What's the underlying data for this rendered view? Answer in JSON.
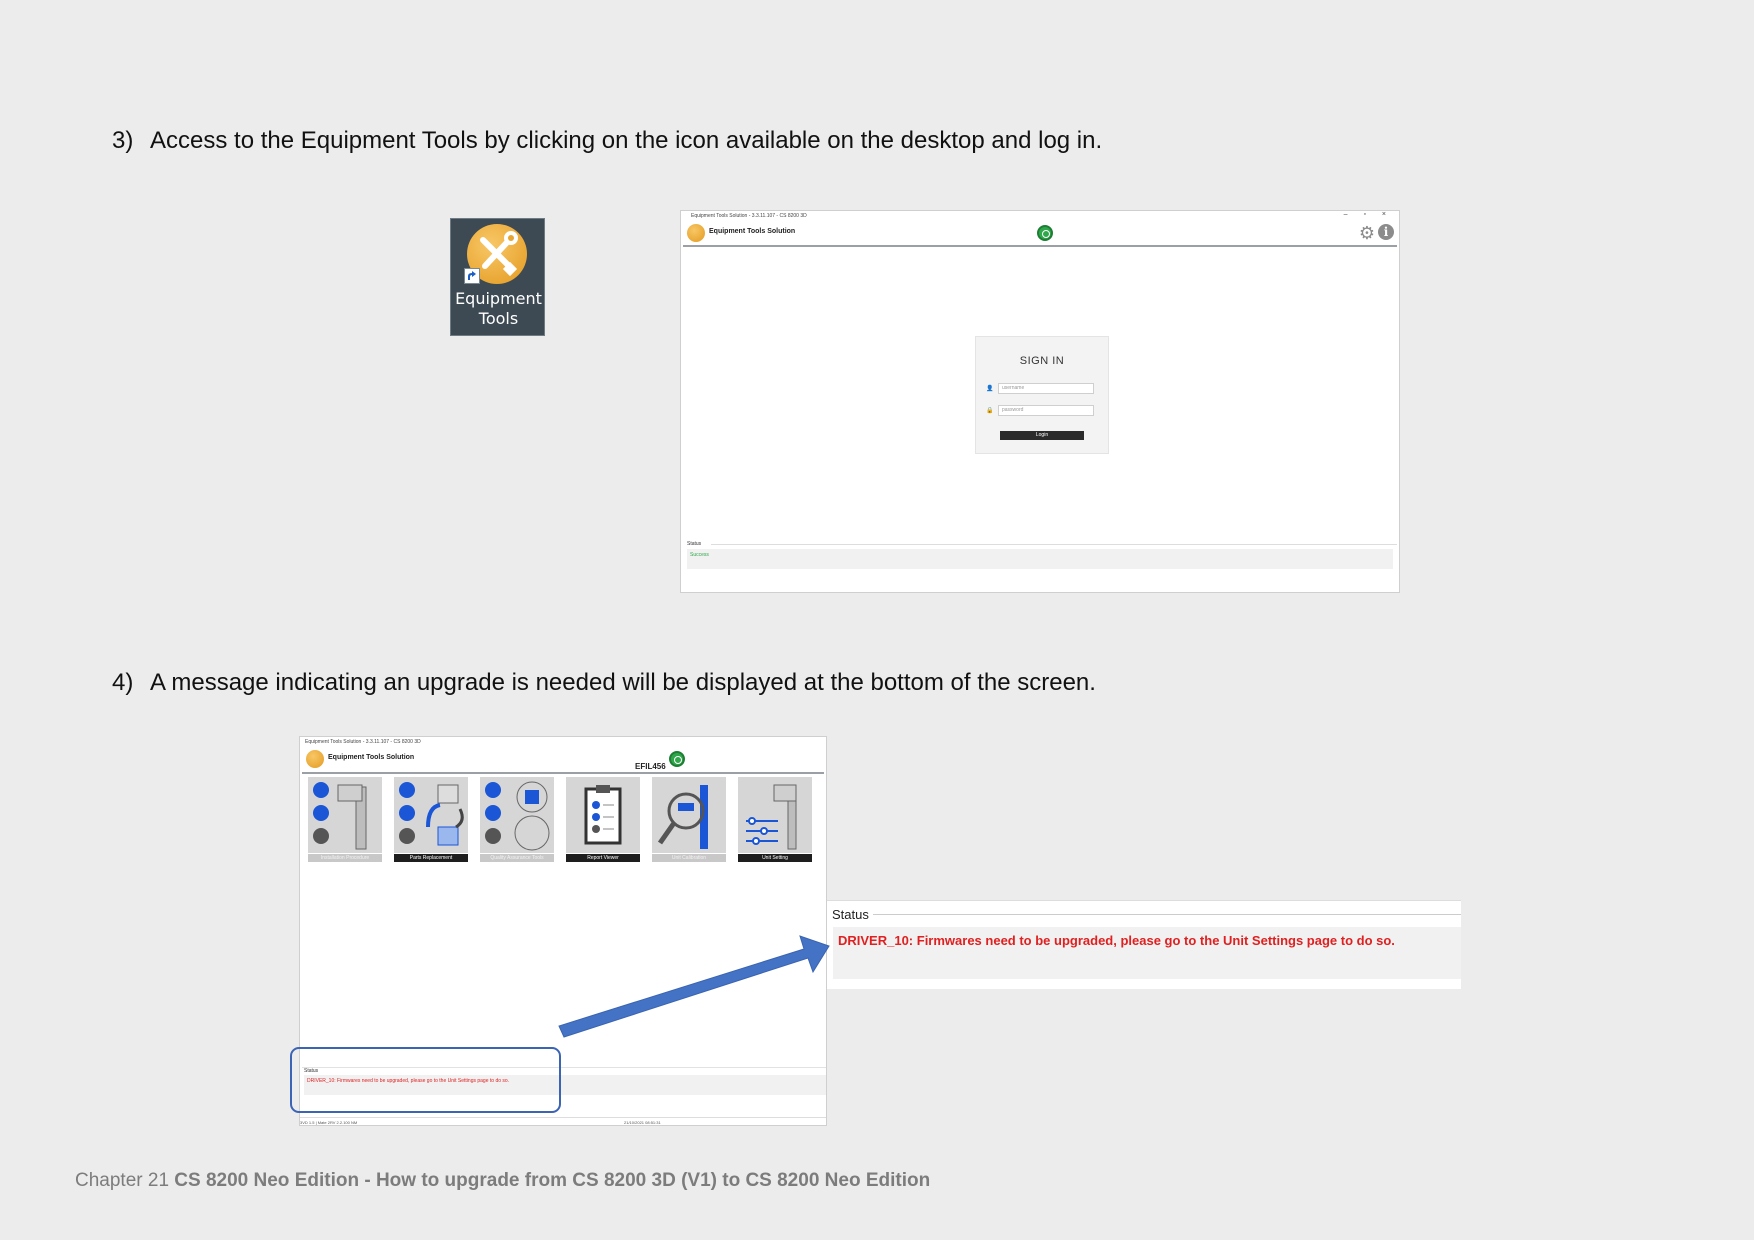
{
  "step3": {
    "number": "3)",
    "text": "Access to the Equipment Tools by clicking on the icon available on the desktop and log in."
  },
  "step4": {
    "number": "4)",
    "text": "A message indicating an upgrade is needed will be displayed at the bottom of the screen."
  },
  "desktop_icon": {
    "label_line1": "Equipment",
    "label_line2": "Tools",
    "icon": "equipment-tools-icon"
  },
  "login_window": {
    "title": "Equipment Tools Solution - 3.3.11.107 - CS 8200 3D",
    "controls": "– ▫ ×",
    "app_name": "Equipment Tools Solution",
    "signin_title": "SIGN IN",
    "username_placeholder": "username",
    "password_placeholder": "password",
    "login_button": "Login",
    "status_label": "Status",
    "status_text": "Success"
  },
  "main_window": {
    "title": "Equipment Tools Solution - 3.3.11.107 - CS 8200 3D",
    "app_name": "Equipment Tools Solution",
    "unit_name": "EFIL456",
    "tiles": [
      {
        "label": "Installation Procedure",
        "enabled": false
      },
      {
        "label": "Parts Replacement",
        "enabled": true
      },
      {
        "label": "Quality Assurance Tools",
        "enabled": false
      },
      {
        "label": "Report Viewer",
        "enabled": true
      },
      {
        "label": "Unit Calibration",
        "enabled": false
      },
      {
        "label": "Unit Setting",
        "enabled": true
      }
    ],
    "status_label": "Status",
    "status_text": "DRIVER_10: Firmwares need to be upgraded, please go to the Unit Settings page to do so.",
    "footer_left": "3VD 1.5 | Mate 2RV 2.2.100 NM",
    "footer_right": "21/10/2021 08:51:31"
  },
  "zoom_status": {
    "label": "Status",
    "message": "DRIVER_10: Firmwares need to be upgraded, please go to the Unit Settings page to do so."
  },
  "colors": {
    "error": "#e02020",
    "accent": "#3c64b4",
    "ok": "#2ea84a"
  },
  "footer": {
    "chapter": "Chapter 21",
    "title": "CS 8200 Neo Edition - How to upgrade from CS 8200 3D (V1) to CS 8200 Neo Edition"
  }
}
